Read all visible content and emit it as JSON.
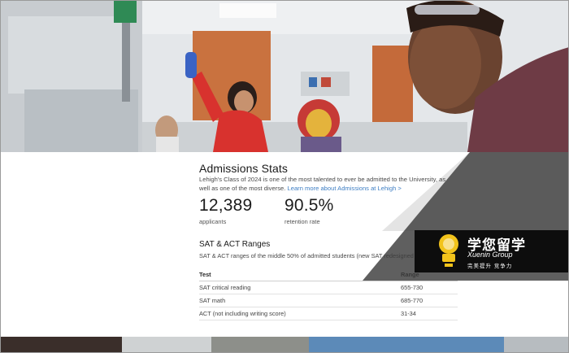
{
  "admissions": {
    "title": "Admissions Stats",
    "intro_text": "Lehigh's Class of 2024 is one of the most talented to ever be admitted to the University, as well as one of the most diverse.",
    "intro_link": "Learn more about Admissions at Lehigh >"
  },
  "stats": [
    {
      "value": "12,389",
      "label": "applicants"
    },
    {
      "value": "90.5%",
      "label": "retention rate"
    }
  ],
  "ranges": {
    "title": "SAT & ACT Ranges",
    "description": "SAT & ACT ranges of the middle 50% of admitted students (new SAT redesigned",
    "columns": [
      "Test",
      "Range"
    ],
    "rows": [
      {
        "test": "SAT critical reading",
        "range": "655-730"
      },
      {
        "test": "SAT math",
        "range": "685-770"
      },
      {
        "test": "ACT (not including writing score)",
        "range": "31-34"
      }
    ]
  },
  "watermark": {
    "cn": "学您留学",
    "en": "Xuenin Group",
    "sub": "完美提升  竞争力"
  },
  "colors": {
    "link": "#3f7fc4",
    "overlay": "#4a4a4a",
    "maroon": "#6e3b45"
  }
}
